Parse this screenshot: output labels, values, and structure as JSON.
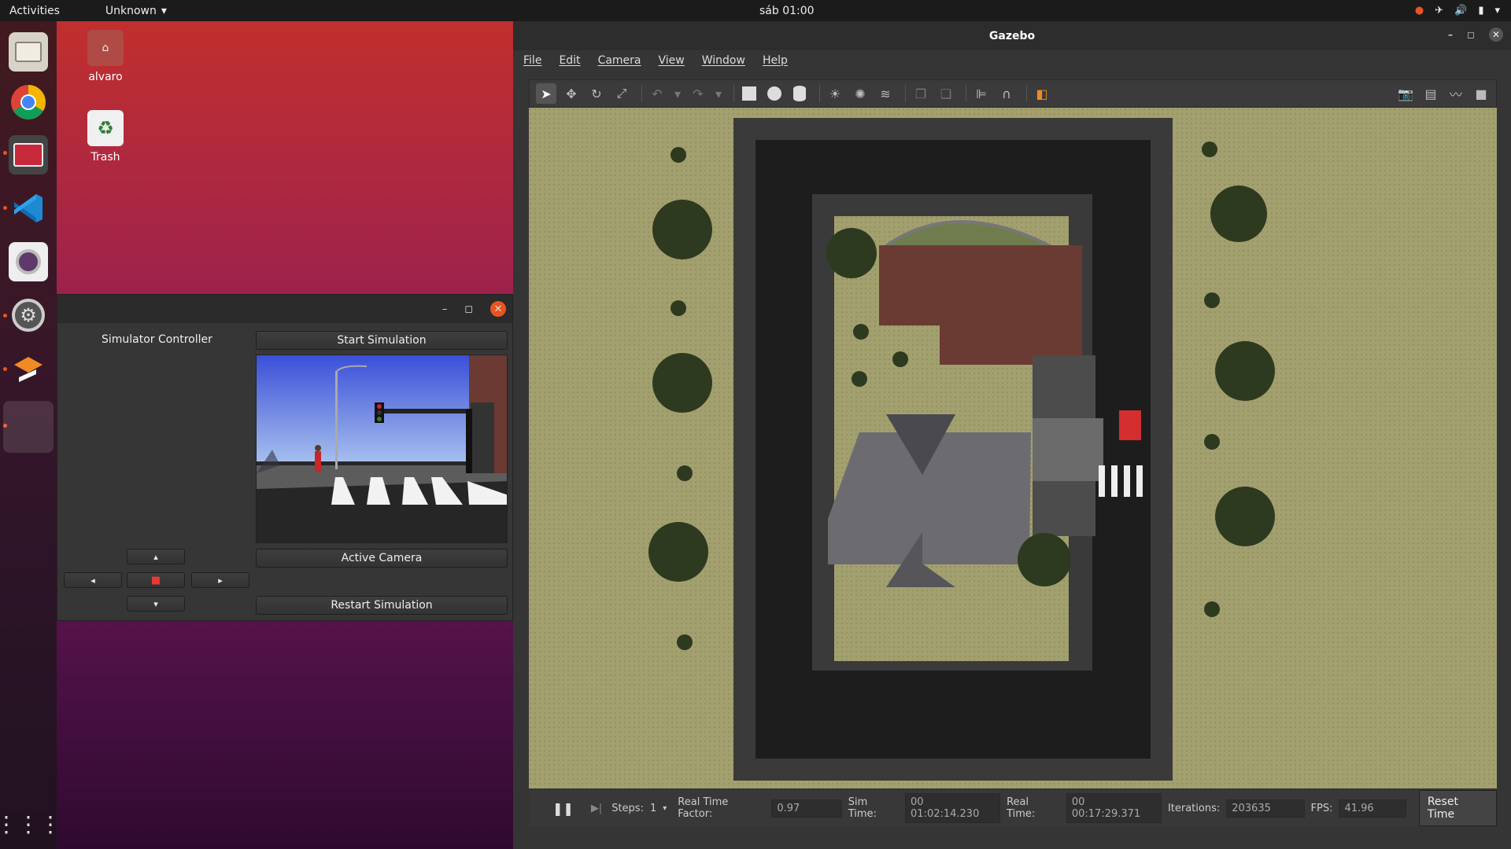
{
  "topbar": {
    "activities": "Activities",
    "app_menu": "Unknown",
    "clock": "sáb 01:00"
  },
  "desktop_icons": [
    {
      "label": "alvaro"
    },
    {
      "label": "Trash"
    }
  ],
  "simulator": {
    "heading": "Simulator Controller",
    "start_label": "Start Simulation",
    "active_camera_label": "Active Camera",
    "restart_label": "Restart Simulation",
    "window_controls": {
      "minimize": "–",
      "maximize": "◻",
      "close": "✕"
    },
    "arrows": {
      "up": "▴",
      "down": "▾",
      "left": "◂",
      "right": "▸",
      "stop": "■"
    }
  },
  "gazebo": {
    "title": "Gazebo",
    "menu": [
      "File",
      "Edit",
      "Camera",
      "View",
      "Window",
      "Help"
    ],
    "status": {
      "steps_label": "Steps:",
      "steps_value": "1",
      "rtf_label": "Real Time Factor:",
      "rtf_value": "0.97",
      "sim_time_label": "Sim Time:",
      "sim_time_value": "00 01:02:14.230",
      "real_time_label": "Real Time:",
      "real_time_value": "00 00:17:29.371",
      "iterations_label": "Iterations:",
      "iterations_value": "203635",
      "fps_label": "FPS:",
      "fps_value": "41.96",
      "reset_label": "Reset Time"
    }
  },
  "colors": {
    "accent": "#e95420",
    "ground": "#a09a6a",
    "road": "#1f1f1f"
  }
}
